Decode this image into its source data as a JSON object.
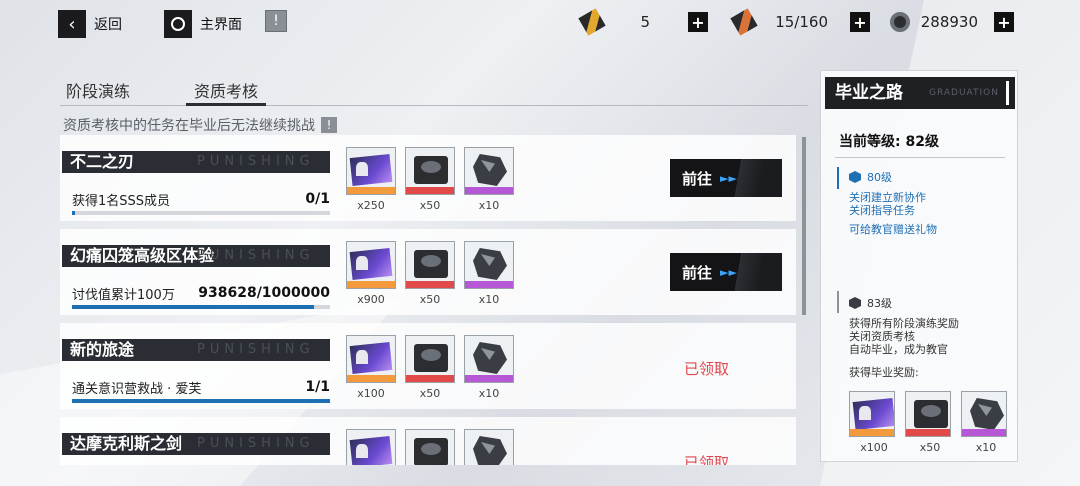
{
  "topbar": {
    "back_label": "返回",
    "home_label": "主界面",
    "back_icon": "chevron-left-icon",
    "home_icon": "circle-icon",
    "info_icon": "info-icon",
    "resources": [
      {
        "icon": "stamina-ticket-icon",
        "value": "5"
      },
      {
        "icon": "blackcard-icon",
        "value": "15/160"
      },
      {
        "icon": "coin-icon",
        "value": "288930"
      }
    ],
    "plus": "+"
  },
  "tabs": [
    {
      "label": "阶段演练"
    },
    {
      "label": "资质考核"
    }
  ],
  "notice": {
    "text": "资质考核中的任务在毕业后无法继续挑战",
    "icon": "!"
  },
  "tasks": [
    {
      "title": "不二之刃",
      "watermark": "PUNISHING",
      "desc": "获得1名SSS成员",
      "progress": "0/1",
      "progress_fraction": 0.0,
      "rewards": [
        {
          "type": "card",
          "qty": "x250"
        },
        {
          "type": "chip",
          "qty": "x50"
        },
        {
          "type": "rock",
          "qty": "x10"
        }
      ],
      "action": "goto",
      "action_label": "前往",
      "arrow": "►►"
    },
    {
      "title": "幻痛囚笼高级区体验",
      "watermark": "PUNISHING",
      "desc": "讨伐值累计100万",
      "progress": "938628/1000000",
      "progress_fraction": 0.9386,
      "rewards": [
        {
          "type": "card",
          "qty": "x900"
        },
        {
          "type": "chip",
          "qty": "x50"
        },
        {
          "type": "rock",
          "qty": "x10"
        }
      ],
      "action": "goto",
      "action_label": "前往",
      "arrow": "►►"
    },
    {
      "title": "新的旅途",
      "watermark": "PUNISHING",
      "desc": "通关意识营救战 · 爱芙",
      "progress": "1/1",
      "progress_fraction": 1.0,
      "rewards": [
        {
          "type": "card",
          "qty": "x100"
        },
        {
          "type": "chip",
          "qty": "x50"
        },
        {
          "type": "rock",
          "qty": "x10"
        }
      ],
      "action": "claimed",
      "action_label": "已领取"
    },
    {
      "title": "达摩克利斯之剑",
      "watermark": "PUNISHING",
      "desc": "",
      "progress": "",
      "progress_fraction": 0.0,
      "rewards": [
        {
          "type": "card",
          "qty": ""
        },
        {
          "type": "chip",
          "qty": ""
        },
        {
          "type": "rock",
          "qty": ""
        }
      ],
      "action": "claimed",
      "action_label": "已领取"
    }
  ],
  "panel": {
    "title": "毕业之路",
    "subtitle": "GRADUATION",
    "current_level": "当前等级: 82级",
    "milestones": [
      {
        "level": "80级",
        "lines": [
          "关闭建立新协作",
          "关闭指导任务",
          "",
          "可给教官赠送礼物"
        ],
        "color": "#1f6fb3"
      },
      {
        "level": "83级",
        "lines": [
          "获得所有阶段演练奖励",
          "关闭资质考核",
          "自动毕业，成为教官",
          "",
          "获得毕业奖励:"
        ],
        "color": "#3a3e44"
      }
    ],
    "rewards": [
      {
        "type": "card",
        "qty": "x100"
      },
      {
        "type": "chip",
        "qty": "x50"
      },
      {
        "type": "rock",
        "qty": "x10"
      }
    ]
  }
}
